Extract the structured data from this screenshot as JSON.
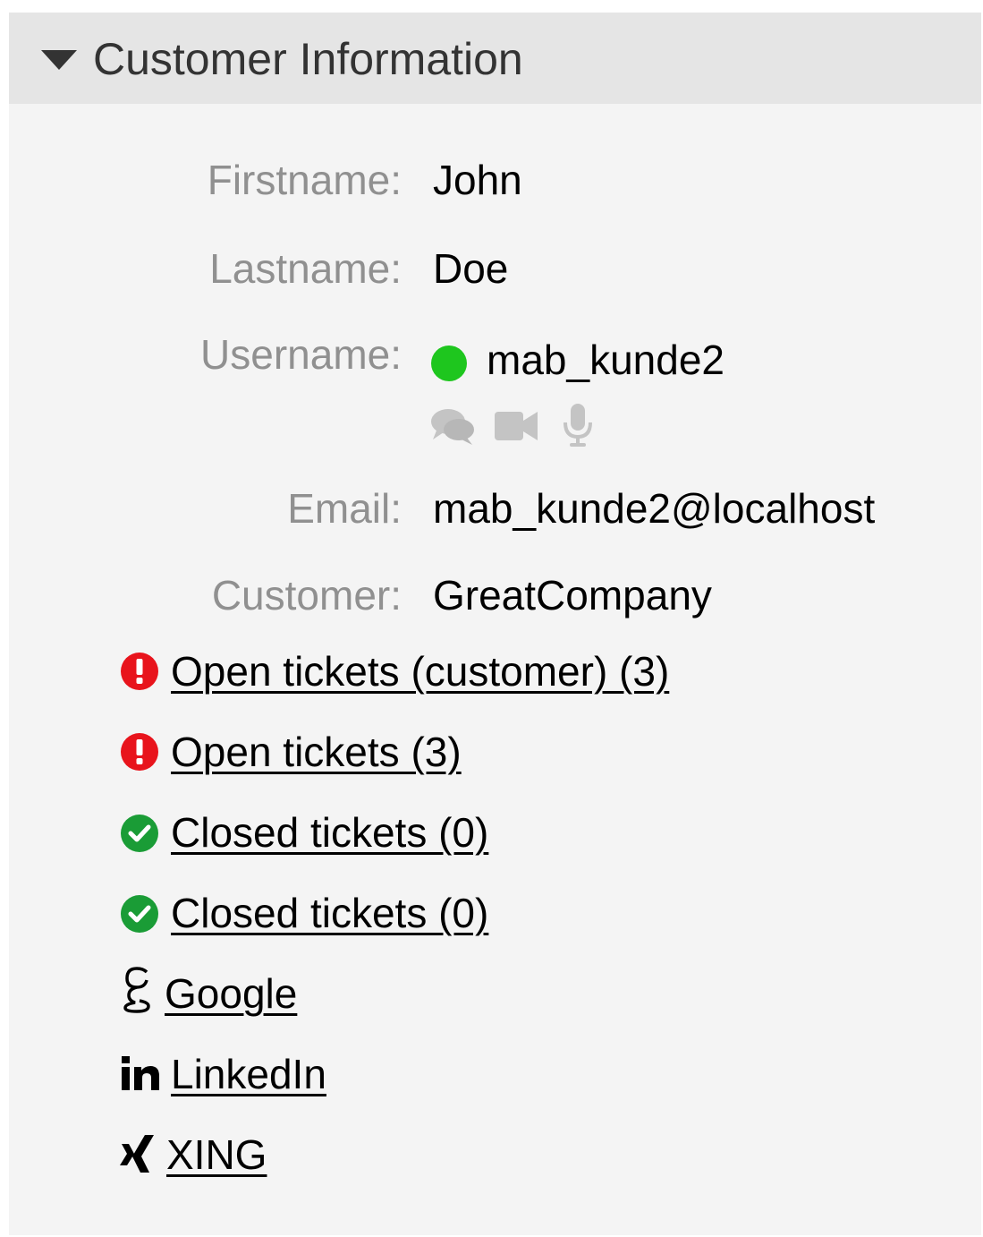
{
  "header": {
    "title": "Customer Information"
  },
  "fields": {
    "firstname": {
      "label": "Firstname:",
      "value": "John"
    },
    "lastname": {
      "label": "Lastname:",
      "value": "Doe"
    },
    "username": {
      "label": "Username:",
      "value": "mab_kunde2"
    },
    "email": {
      "label": "Email:",
      "value": "mab_kunde2@localhost"
    },
    "customer": {
      "label": "Customer:",
      "value": "GreatCompany"
    }
  },
  "presence": {
    "status_color": "#1ec61e",
    "icons": [
      "chat-icon",
      "video-icon",
      "microphone-icon"
    ]
  },
  "tickets": [
    {
      "label": "Open tickets (customer) (3)",
      "icon": "alert-icon",
      "color": "#e8141c"
    },
    {
      "label": "Open tickets (3)",
      "icon": "alert-icon",
      "color": "#e8141c"
    },
    {
      "label": "Closed tickets (0)",
      "icon": "check-icon",
      "color": "#1a9c36"
    },
    {
      "label": "Closed tickets (0)",
      "icon": "check-icon",
      "color": "#1a9c36"
    }
  ],
  "social": [
    {
      "label": "Google",
      "icon": "google-icon"
    },
    {
      "label": "LinkedIn",
      "icon": "linkedin-icon"
    },
    {
      "label": "XING",
      "icon": "xing-icon"
    }
  ]
}
